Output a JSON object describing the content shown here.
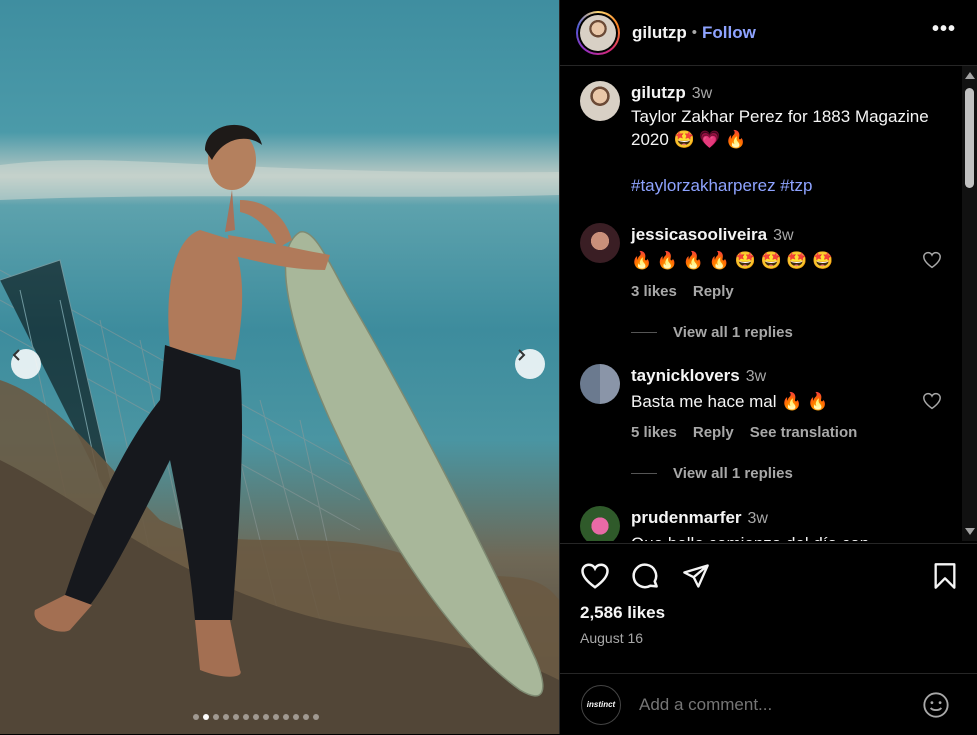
{
  "post": {
    "username": "gilutzp",
    "follow_label": "Follow",
    "separator": "•",
    "more_label": "•••",
    "likes": "2,586 likes",
    "date": "August 16",
    "carousel": {
      "count": 13,
      "active_index": 1
    }
  },
  "caption": {
    "username": "gilutzp",
    "time": "3w",
    "text": "Taylor Zakhar Perez for 1883 Magazine 2020 🤩 💗 🔥",
    "hashtags": "#taylorzakharperez #tzp"
  },
  "comments": [
    {
      "username": "jessicasooliveira",
      "time": "3w",
      "text": "🔥 🔥 🔥 🔥 🤩 🤩 🤩 🤩",
      "likes": "3 likes",
      "reply": "Reply",
      "translation": "",
      "view_replies": "View all 1 replies"
    },
    {
      "username": "taynicklovers",
      "time": "3w",
      "text": "Basta me hace mal 🔥 🔥",
      "likes": "5 likes",
      "reply": "Reply",
      "translation": "See translation",
      "view_replies": "View all 1 replies"
    },
    {
      "username": "prudenmarfer",
      "time": "3w",
      "text": "Que bello comienzo del día con"
    }
  ],
  "composer": {
    "placeholder": "Add a comment...",
    "avatar_text": "instinct"
  },
  "icons": {
    "like": "heart-icon",
    "comment": "comment-icon",
    "share": "share-icon",
    "save": "bookmark-icon",
    "emoji": "emoji-icon",
    "prev": "chevron-left-icon",
    "next": "chevron-right-icon"
  },
  "colors": {
    "link": "#8ea3ff",
    "secondary": "#a8a8a8",
    "background": "#000000"
  }
}
